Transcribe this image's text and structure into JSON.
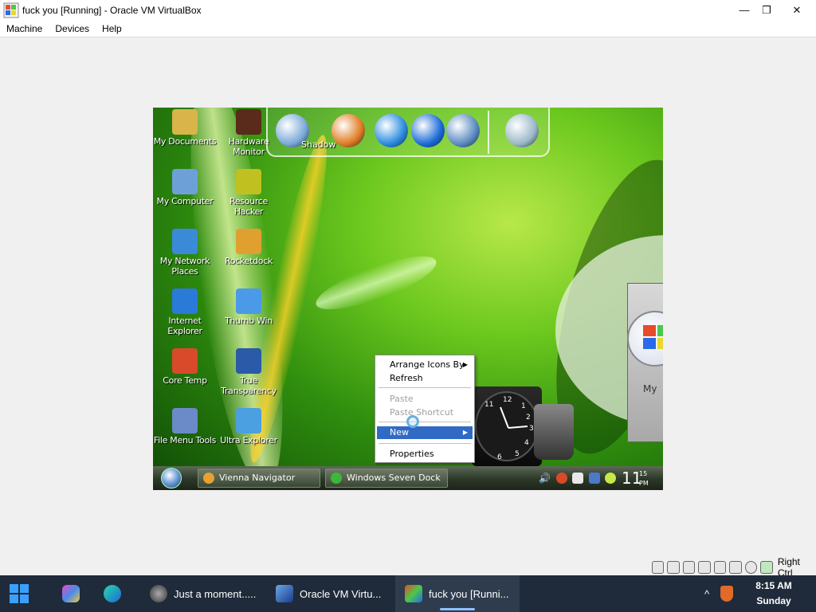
{
  "window": {
    "title": "fuck you [Running] - Oracle VM VirtualBox",
    "minimize": "—",
    "restore": "❐",
    "close": "✕"
  },
  "menu": [
    "Machine",
    "Devices",
    "Help"
  ],
  "guest": {
    "desktop_icons": [
      {
        "label": "My Documents",
        "icon": "folder-icon",
        "color": "#d8b44a"
      },
      {
        "label": "Hardware Monitor",
        "icon": "chip-icon",
        "color": "#5a2a1a"
      },
      {
        "label": "My Computer",
        "icon": "computer-icon",
        "color": "#6ea0d8"
      },
      {
        "label": "Resource Hacker",
        "icon": "hammer-icon",
        "color": "#c0c020"
      },
      {
        "label": "My Network Places",
        "icon": "globe-icon",
        "color": "#3a8ad8"
      },
      {
        "label": "Rocketdock",
        "icon": "rocketdock-icon",
        "color": "#e0a030"
      },
      {
        "label": "Internet Explorer",
        "icon": "ie-icon",
        "color": "#2a7ad8"
      },
      {
        "label": "Thumb Win",
        "icon": "thumbnail-icon",
        "color": "#4a9ae8"
      },
      {
        "label": "Core Temp",
        "icon": "thermometer-icon",
        "color": "#d84a2a"
      },
      {
        "label": "True Transparency",
        "icon": "tt-icon",
        "color": "#2a5aa8"
      },
      {
        "label": "File Menu Tools",
        "icon": "document-icon",
        "color": "#6a8ac8"
      },
      {
        "label": "Ultra Explorer",
        "icon": "explorer-icon",
        "color": "#4aa0e0"
      }
    ],
    "dock": {
      "shadow_label": "Shadow",
      "items": [
        {
          "name": "computer-dock-icon",
          "color": "#7aa8d8"
        },
        {
          "name": "firefox-dock-icon",
          "color": "#e07a20"
        },
        {
          "name": "ie-dock-icon",
          "color": "#2a8ae0"
        },
        {
          "name": "media-player-dock-icon",
          "color": "#1a6ad8"
        },
        {
          "name": "network-dock-icon",
          "color": "#5a8ac0"
        },
        {
          "name": "recycle-bin-dock-icon",
          "color": "#9ab8c8"
        }
      ]
    },
    "orb_label": "My",
    "clock_numbers": [
      "12",
      "1",
      "2",
      "3",
      "4",
      "5",
      "6",
      "11"
    ],
    "context_menu": {
      "items": [
        {
          "label": "Arrange Icons By",
          "state": "normal",
          "submenu": true
        },
        {
          "label": "Refresh",
          "state": "normal",
          "submenu": false
        },
        {
          "label": "Paste",
          "state": "disabled",
          "submenu": false
        },
        {
          "label": "Paste Shortcut",
          "state": "disabled",
          "submenu": false
        },
        {
          "label": "New",
          "state": "selected",
          "submenu": true
        },
        {
          "label": "Properties",
          "state": "normal",
          "submenu": false
        }
      ],
      "arrow": "▶"
    },
    "taskbar": {
      "buttons": [
        "Vienna Navigator",
        "Windows Seven Dock"
      ],
      "clock_hour": "11",
      "clock_minutes": "15",
      "clock_ampm": "PM",
      "volume": "🔊"
    }
  },
  "statusbar": {
    "host_key": "Right Ctrl"
  },
  "host_taskbar": {
    "items": [
      {
        "label": "Just a moment.....",
        "icon": "browser-icon"
      },
      {
        "label": "Oracle VM Virtu...",
        "icon": "virtualbox-icon"
      },
      {
        "label": "fuck you [Runni...",
        "icon": "vm-window-icon"
      }
    ],
    "chevron": "^",
    "time": "8:15 AM",
    "day": "Sunday"
  }
}
